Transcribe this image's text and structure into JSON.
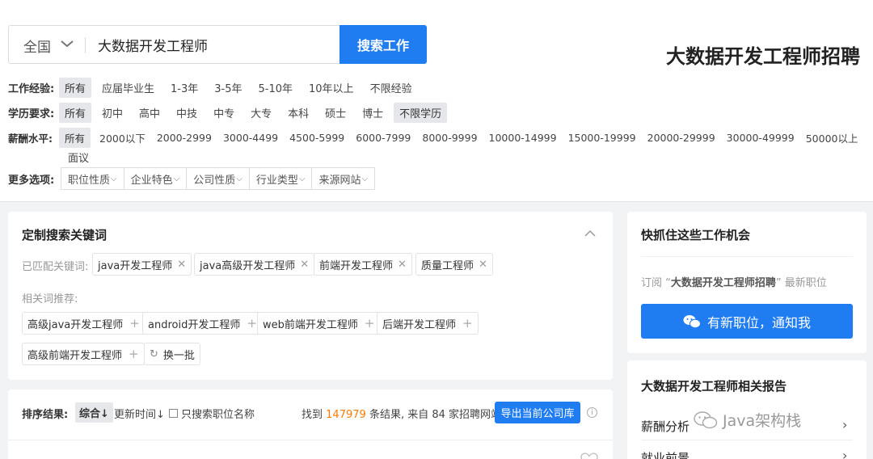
{
  "search": {
    "region": "全国",
    "query": "大数据开发工程师",
    "button": "搜索工作"
  },
  "page_title": "大数据开发工程师招聘",
  "filters": {
    "experience": {
      "label": "工作经验:",
      "options": [
        "所有",
        "应届毕业生",
        "1-3年",
        "3-5年",
        "5-10年",
        "10年以上",
        "不限经验"
      ]
    },
    "education": {
      "label": "学历要求:",
      "options": [
        "所有",
        "初中",
        "高中",
        "中技",
        "中专",
        "大专",
        "本科",
        "硕士",
        "博士",
        "不限学历"
      ]
    },
    "salary": {
      "label": "薪酬水平:",
      "options": [
        "所有",
        "2000以下",
        "2000-2999",
        "3000-4499",
        "4500-5999",
        "6000-7999",
        "8000-9999",
        "10000-14999",
        "15000-19999",
        "20000-29999",
        "30000-49999",
        "50000以上"
      ],
      "extra": "面议"
    },
    "more": {
      "label": "更多选项:",
      "selects": [
        "职位性质",
        "企业特色",
        "公司性质",
        "行业类型",
        "来源网站"
      ]
    }
  },
  "keywords": {
    "title": "定制搜索关键词",
    "matched_label": "已匹配关键词:",
    "matched": [
      "java开发工程师",
      "java高级开发工程师",
      "前端开发工程师",
      "质量工程师"
    ],
    "related_label": "相关词推荐:",
    "related": [
      "高级java开发工程师",
      "android开发工程师",
      "web前端开发工程师",
      "后端开发工程师",
      "高级前端开发工程师"
    ],
    "refresh": "换一批"
  },
  "sort": {
    "label": "排序结果:",
    "options": [
      "综合↓",
      "更新时间↓"
    ],
    "title_only": "只搜索职位名称",
    "result_prefix": "找到",
    "result_count": "147979",
    "result_mid": "条结果, 来自",
    "site_count": "84",
    "result_suffix": "家招聘网站",
    "export": "导出当前公司库"
  },
  "side": {
    "title": "快抓住这些工作机会",
    "sub_prefix": "订阅 “",
    "sub_keyword": "大数据开发工程师招聘",
    "sub_suffix": "” 最新职位",
    "notify": "有新职位，通知我"
  },
  "reports": {
    "title": "大数据开发工程师相关报告",
    "items": [
      "薪酬分析",
      "就业前景"
    ]
  },
  "watermark": "Java架构栈",
  "colors": {
    "accent": "#1f7cf1",
    "highlight": "#ff7a00"
  },
  "icons": [
    "chevron-down-icon",
    "close-icon",
    "plus-icon",
    "refresh-icon",
    "info-icon",
    "wechat-icon",
    "chevron-up-icon",
    "chevron-right-icon",
    "heart-icon"
  ]
}
